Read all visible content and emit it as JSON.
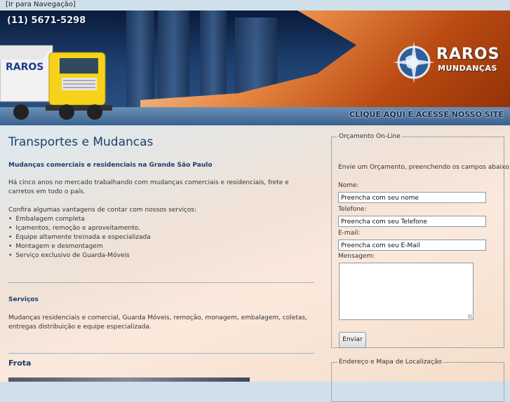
{
  "skip_link": "[Ir para Navegação]",
  "header": {
    "phone": "(11) 5671-5298",
    "logo_line1": "RAROS",
    "logo_line2": "MUNDANÇAS",
    "truck_brand": "RAROS",
    "cta": "CLIQUE AQUI E ACESSE NOSSO SITE"
  },
  "main": {
    "title": "Transportes e Mudancas",
    "subtitle": "Mudanças comerciais e residenciais na Grande São Paulo",
    "intro": "Há cinco anos no mercado trabalhando com mudanças comerciais e residenciais, frete e carretos em todo o país.",
    "advantages_heading": "Confira algumas vantagens de contar com nossos serviços:",
    "advantages": [
      "Embalagem completa",
      "Içamentos, remoção e aproveitamento.",
      "Equipe altamente treinada e especializada",
      "Montagem e desmontagem",
      "Serviço exclusivo de Guarda-Móveis"
    ],
    "services_title": "Serviços",
    "services_text": "Mudanças residenciais e comercial, Guarda Móveis, remoção, monagem, embalagem, coletas, entregas distribuição e equipe especializada.",
    "fleet_title": "Frota"
  },
  "quote_form": {
    "legend": "Orçamento On-Line",
    "intro": "Envie um Orçamento, preenchendo os campos abaixo:",
    "name_label": "Nome:",
    "name_value": "Preencha com seu nome",
    "phone_label": "Telefone:",
    "phone_value": "Preencha com seu Telefone",
    "email_label": "E-mail:",
    "email_value": "Preencha com seu E-Mail",
    "message_label": "Mensagem:",
    "submit_label": "Enviar"
  },
  "location_box": {
    "legend": "Endereço e Mapa de Localização"
  }
}
